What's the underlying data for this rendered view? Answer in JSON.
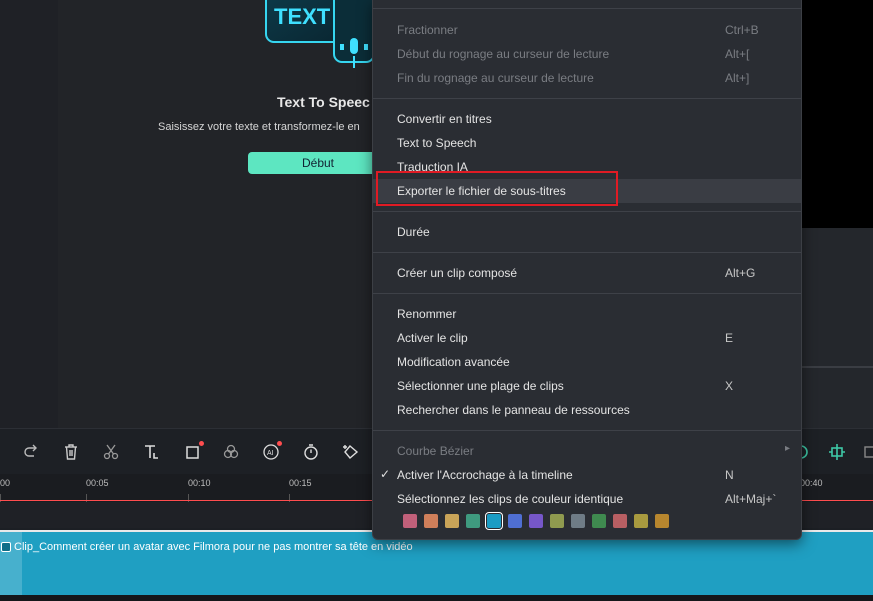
{
  "media_panel": {
    "art_label": "TEXT",
    "title": "Text To Speec",
    "description": "Saisissez votre texte et transformez-le en",
    "start_button": "Début"
  },
  "context_menu": {
    "groups": [
      [
        {
          "label": "Fractionner",
          "shortcut": "Ctrl+B",
          "disabled": true
        },
        {
          "label": "Début du rognage au curseur de lecture",
          "shortcut": "Alt+[",
          "disabled": true
        },
        {
          "label": "Fin du rognage au curseur de lecture",
          "shortcut": "Alt+]",
          "disabled": true
        }
      ],
      [
        {
          "label": "Convertir en titres",
          "shortcut": ""
        },
        {
          "label": "Text to Speech",
          "shortcut": ""
        },
        {
          "label": "Traduction IA",
          "shortcut": ""
        },
        {
          "label": "Exporter le fichier de sous-titres",
          "shortcut": "",
          "hover": true
        }
      ],
      [
        {
          "label": "Durée",
          "shortcut": ""
        }
      ],
      [
        {
          "label": "Créer un clip composé",
          "shortcut": "Alt+G"
        }
      ],
      [
        {
          "label": "Renommer",
          "shortcut": ""
        },
        {
          "label": "Activer le clip",
          "shortcut": "E"
        },
        {
          "label": "Modification avancée",
          "shortcut": ""
        },
        {
          "label": "Sélectionner une plage de clips",
          "shortcut": "X"
        },
        {
          "label": "Rechercher dans le panneau de ressources",
          "shortcut": ""
        }
      ],
      [
        {
          "label": "Courbe Bézier",
          "shortcut": "",
          "disabled": true,
          "submenu": true
        },
        {
          "label": "Activer l'Accrochage à la timeline",
          "shortcut": "N",
          "checked": true
        },
        {
          "label": "Sélectionnez les clips de couleur identique",
          "shortcut": "Alt+Maj+`"
        }
      ]
    ],
    "color_swatches": [
      "#c1607a",
      "#cf7f5a",
      "#c9a458",
      "#3f9a7f",
      "#1b9cc4",
      "#4f6fd3",
      "#7657c9",
      "#8f9a4f",
      "#6f7c86",
      "#3f8a4f",
      "#b85f63",
      "#a89a3f",
      "#b7862e"
    ],
    "selected_swatch": 4
  },
  "timeline": {
    "ruler_labels": [
      "00",
      "00:05",
      "00:10",
      "00:15",
      "00:40"
    ],
    "clip_title": "Clip_Comment créer un avatar avec Filmora pour ne pas montrer sa tête en vidéo"
  },
  "toolbar": {
    "icons": [
      "redo-icon",
      "delete-icon",
      "cut-icon",
      "text-icon",
      "crop-icon",
      "color-icon",
      "ai-icon",
      "speed-icon",
      "keyframe-icon"
    ]
  }
}
